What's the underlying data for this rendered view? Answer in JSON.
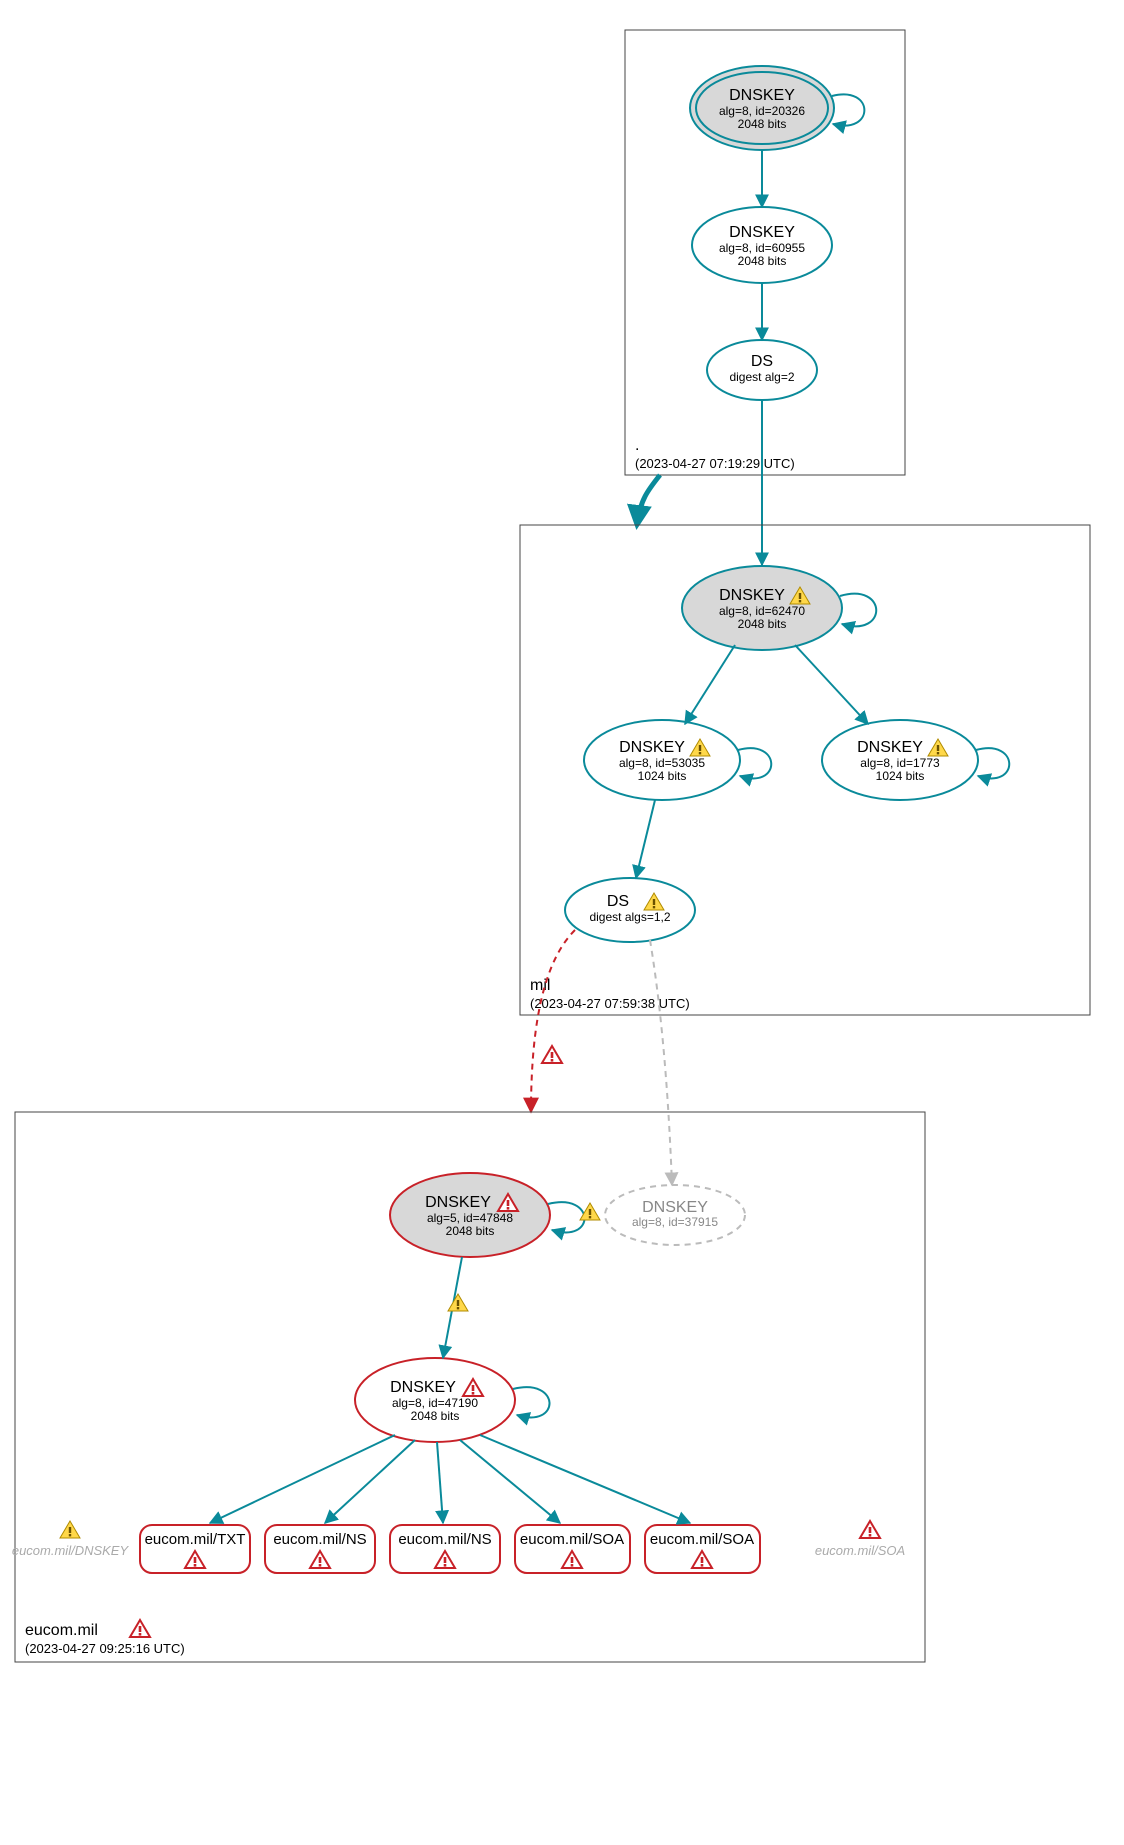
{
  "zones": {
    "root": {
      "name": ".",
      "timestamp": "(2023-04-27 07:19:29 UTC)",
      "nodes": {
        "ksk": {
          "title": "DNSKEY",
          "line2": "alg=8, id=20326",
          "line3": "2048 bits"
        },
        "zsk": {
          "title": "DNSKEY",
          "line2": "alg=8, id=60955",
          "line3": "2048 bits"
        },
        "ds": {
          "title": "DS",
          "line2": "digest alg=2"
        }
      }
    },
    "mil": {
      "name": "mil",
      "timestamp": "(2023-04-27 07:59:38 UTC)",
      "nodes": {
        "ksk": {
          "title": "DNSKEY",
          "line2": "alg=8, id=62470",
          "line3": "2048 bits"
        },
        "zsk1": {
          "title": "DNSKEY",
          "line2": "alg=8, id=53035",
          "line3": "1024 bits"
        },
        "zsk2": {
          "title": "DNSKEY",
          "line2": "alg=8, id=1773",
          "line3": "1024 bits"
        },
        "ds": {
          "title": "DS",
          "line2": "digest algs=1,2"
        }
      }
    },
    "eucom": {
      "name": "eucom.mil",
      "timestamp": "(2023-04-27 09:25:16 UTC)",
      "nodes": {
        "ksk": {
          "title": "DNSKEY",
          "line2": "alg=5, id=47848",
          "line3": "2048 bits"
        },
        "zsk": {
          "title": "DNSKEY",
          "line2": "alg=8, id=47190",
          "line3": "2048 bits"
        },
        "ghost": {
          "title": "DNSKEY",
          "line2": "alg=8, id=37915"
        }
      },
      "records": {
        "txt": "eucom.mil/TXT",
        "ns1": "eucom.mil/NS",
        "ns2": "eucom.mil/NS",
        "soa1": "eucom.mil/SOA",
        "soa2": "eucom.mil/SOA"
      },
      "side": {
        "left": "eucom.mil/DNSKEY",
        "right": "eucom.mil/SOA"
      }
    }
  },
  "colors": {
    "teal": "#0a8a9a",
    "red": "#c82128",
    "grey": "#d8d8d8",
    "ghost": "#bbbbbb"
  }
}
